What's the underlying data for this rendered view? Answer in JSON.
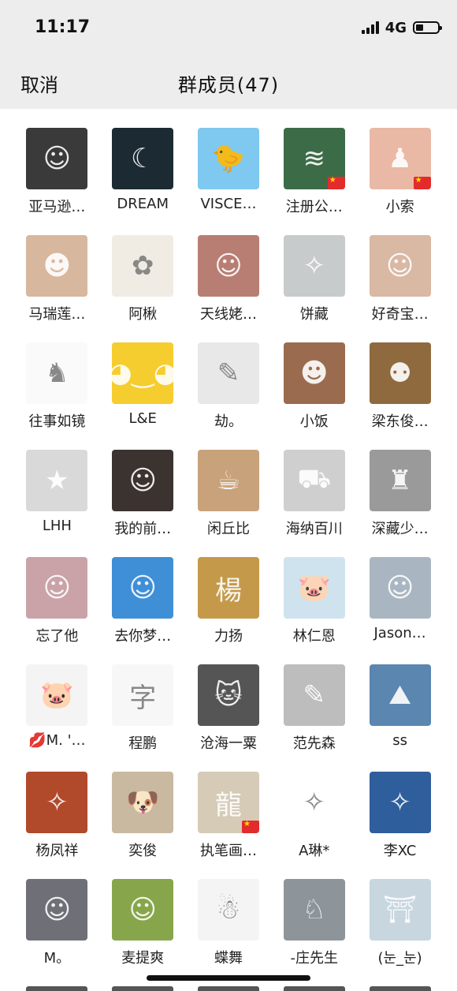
{
  "status_bar": {
    "time": "11:17",
    "network": "4G"
  },
  "nav": {
    "cancel_label": "取消",
    "title": "群成员(47)"
  },
  "members": [
    {
      "name": "亚马逊…",
      "color": "#3a3a3a",
      "icon": "person-icon",
      "flag": false
    },
    {
      "name": "DREAM",
      "color": "#1c2b33",
      "icon": "night-icon",
      "flag": false
    },
    {
      "name": "VISCE…",
      "color": "#7fc8ef",
      "icon": "bird-icon",
      "flag": false
    },
    {
      "name": "注册公…",
      "color": "#3c6b48",
      "icon": "waterfall-icon",
      "flag": true
    },
    {
      "name": "小索",
      "color": "#e9b9a6",
      "icon": "silhouette-icon",
      "flag": true
    },
    {
      "name": "马瑞莲…",
      "color": "#d8b79f",
      "icon": "child-icon",
      "flag": false
    },
    {
      "name": "阿楸",
      "color": "#f0ece4",
      "icon": "cartoon-icon",
      "flag": false
    },
    {
      "name": "天线姥…",
      "color": "#b87e73",
      "icon": "person-icon",
      "flag": false
    },
    {
      "name": "饼藏",
      "color": "#c7cbcc",
      "icon": "anime-icon",
      "flag": false
    },
    {
      "name": "好奇宝…",
      "color": "#d9b8a4",
      "icon": "person-icon",
      "flag": false
    },
    {
      "name": "往事如镜",
      "color": "#fafafa",
      "icon": "tiny-figure-icon",
      "flag": false
    },
    {
      "name": "L&E",
      "color": "#f6cd2e",
      "icon": "emoji-icon",
      "flag": false
    },
    {
      "name": "劫。",
      "color": "#e8e8e8",
      "icon": "sketch-icon",
      "flag": false
    },
    {
      "name": "小饭",
      "color": "#9a6b4e",
      "icon": "child-icon",
      "flag": false
    },
    {
      "name": "梁东俊…",
      "color": "#8e6a3e",
      "icon": "tiger-icon",
      "flag": false
    },
    {
      "name": "LHH",
      "color": "#d9d9d9",
      "icon": "starfish-icon",
      "flag": false
    },
    {
      "name": "我的前…",
      "color": "#3b3330",
      "icon": "person-icon",
      "flag": false
    },
    {
      "name": "闲丘比",
      "color": "#c8a27a",
      "icon": "coffee-icon",
      "flag": false
    },
    {
      "name": "海纳百川",
      "color": "#cfcfcf",
      "icon": "car-icon",
      "flag": false
    },
    {
      "name": "深藏少…",
      "color": "#9a9a9a",
      "icon": "statue-icon",
      "flag": false
    },
    {
      "name": "忘了他",
      "color": "#c9a3a8",
      "icon": "person-icon",
      "flag": false
    },
    {
      "name": "去你梦…",
      "color": "#3f8fd7",
      "icon": "smiley-balloon-icon",
      "flag": false
    },
    {
      "name": "力扬",
      "color": "#c49a4a",
      "icon": "calligraphy-icon",
      "flag": false
    },
    {
      "name": "林仁恩",
      "color": "#cfe3ef",
      "icon": "pig-icon",
      "flag": false
    },
    {
      "name": "Jason…",
      "color": "#a9b6c2",
      "icon": "person-icon",
      "flag": false
    },
    {
      "name": "💋M. '…",
      "color": "#f4f4f4",
      "icon": "pig-icon",
      "flag": false
    },
    {
      "name": "程鹏",
      "color": "#f7f7f7",
      "icon": "text-icon",
      "flag": false
    },
    {
      "name": "沧海一粟",
      "color": "#555555",
      "icon": "cat-icon",
      "flag": false
    },
    {
      "name": "范先森",
      "color": "#bdbdbd",
      "icon": "sketch-icon",
      "flag": false
    },
    {
      "name": "ss",
      "color": "#5a86b0",
      "icon": "landscape-icon",
      "flag": false
    },
    {
      "name": "杨凤祥",
      "color": "#b04a2a",
      "icon": "anime-icon",
      "flag": false
    },
    {
      "name": "奕俊",
      "color": "#c9b9a0",
      "icon": "dog-icon",
      "flag": false
    },
    {
      "name": "执笔画…",
      "color": "#d5cbb7",
      "icon": "dragon-icon",
      "flag": true
    },
    {
      "name": "A琳*",
      "color": "#ffffff",
      "icon": "anime-icon",
      "flag": false
    },
    {
      "name": "李XC",
      "color": "#2f5e9c",
      "icon": "anime-icon",
      "flag": false
    },
    {
      "name": "M。",
      "color": "#6f6f78",
      "icon": "person-icon",
      "flag": false
    },
    {
      "name": "麦提爽",
      "color": "#87a64b",
      "icon": "person-icon",
      "flag": false
    },
    {
      "name": "蝶舞",
      "color": "#f4f4f4",
      "icon": "figure-icon",
      "flag": false
    },
    {
      "name": "-庄先生",
      "color": "#8e959a",
      "icon": "deer-icon",
      "flag": false
    },
    {
      "name": "(눈_눈)",
      "color": "#c7d6df",
      "icon": "monument-icon",
      "flag": false
    }
  ],
  "icon_glyphs": {
    "person-icon": "☺",
    "night-icon": "☾",
    "bird-icon": "🐤",
    "waterfall-icon": "≋",
    "silhouette-icon": "♟",
    "child-icon": "☻",
    "cartoon-icon": "✿",
    "anime-icon": "✧",
    "tiny-figure-icon": "♞",
    "emoji-icon": "◕‿◕",
    "sketch-icon": "✎",
    "tiger-icon": "⚉",
    "starfish-icon": "★",
    "coffee-icon": "☕",
    "car-icon": "⛟",
    "statue-icon": "♜",
    "smiley-balloon-icon": "☺",
    "calligraphy-icon": "楊",
    "pig-icon": "🐷",
    "text-icon": "字",
    "cat-icon": "🐱",
    "landscape-icon": "⛰",
    "dog-icon": "🐶",
    "dragon-icon": "龍",
    "figure-icon": "☃",
    "deer-icon": "♘",
    "monument-icon": "⛩"
  }
}
